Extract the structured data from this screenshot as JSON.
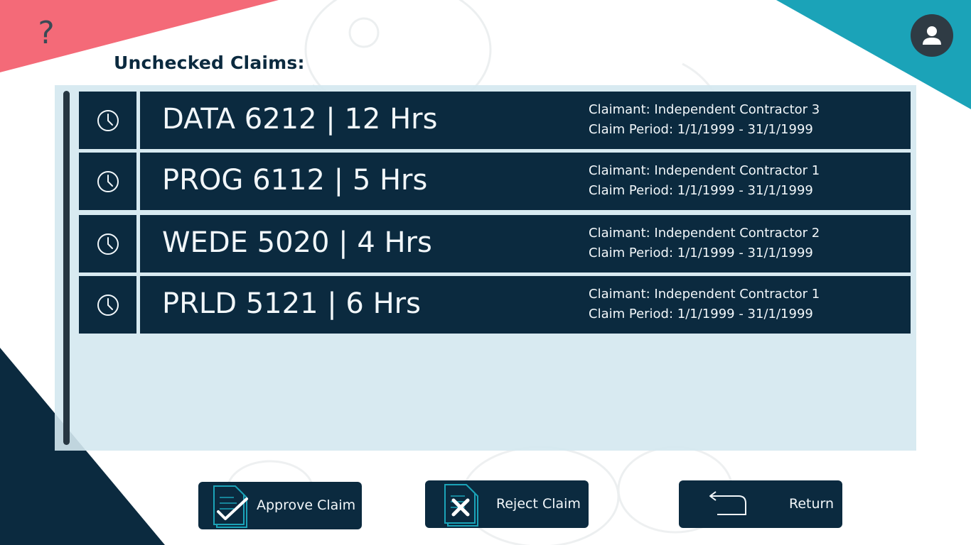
{
  "header": {
    "help_glyph": "?",
    "title": "Unchecked Claims:"
  },
  "claims": [
    {
      "title": "DATA 6212 | 12 Hrs",
      "claimant": "Claimant: Independent Contractor 3",
      "period": "Claim Period: 1/1/1999 - 31/1/1999"
    },
    {
      "title": "PROG 6112 | 5 Hrs",
      "claimant": "Claimant: Independent Contractor 1",
      "period": "Claim Period: 1/1/1999 - 31/1/1999"
    },
    {
      "title": "WEDE 5020 | 4 Hrs",
      "claimant": "Claimant: Independent Contractor 2",
      "period": "Claim Period: 1/1/1999 - 31/1/1999"
    },
    {
      "title": "PRLD 5121 | 6 Hrs",
      "claimant": "Claimant: Independent Contractor 1",
      "period": "Claim Period: 1/1/1999 - 31/1/1999"
    }
  ],
  "actions": {
    "approve_label": "Approve Claim",
    "reject_label": "Reject Claim",
    "return_label": "Return"
  },
  "icons": {
    "help": "question-mark-icon",
    "avatar": "user-icon",
    "claim": "clock-icon",
    "approve": "document-check-icon",
    "reject": "document-x-icon",
    "return": "return-arrow-icon"
  },
  "colors": {
    "navy": "#0b2a3f",
    "panel": "#d4e8f0",
    "coral": "#f46a78",
    "teal": "#1ba3b8",
    "avatar": "#2f3b44",
    "text_light": "#f2f7fa"
  }
}
